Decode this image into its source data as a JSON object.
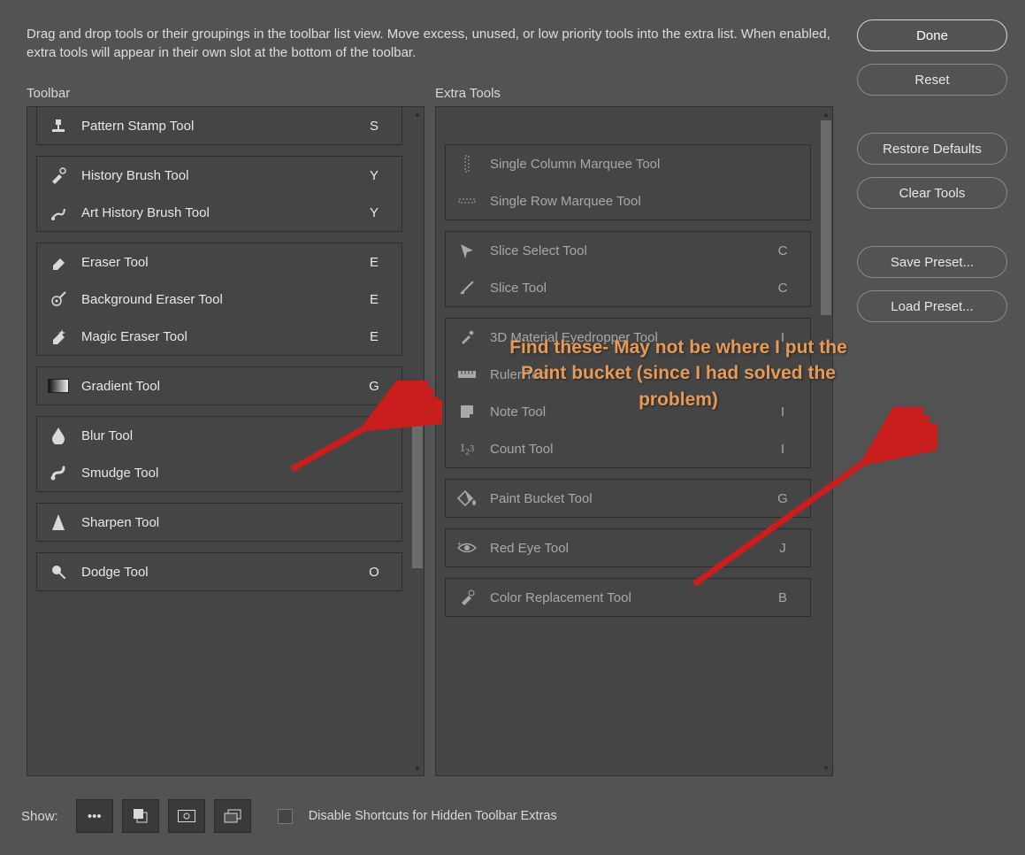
{
  "intro": "Drag and drop tools or their groupings in the toolbar list view. Move excess, unused, or low priority tools into the extra list. When enabled, extra tools will appear in their own slot at the bottom of the toolbar.",
  "section_labels": {
    "toolbar": "Toolbar",
    "extra": "Extra Tools"
  },
  "buttons": {
    "done": "Done",
    "reset": "Reset",
    "restore_defaults": "Restore Defaults",
    "clear_tools": "Clear Tools",
    "save_preset": "Save Preset...",
    "load_preset": "Load Preset..."
  },
  "bottom": {
    "show_label": "Show:",
    "disable_shortcuts_label": "Disable Shortcuts for Hidden Toolbar Extras"
  },
  "annotation": "Find these- May not be where I put the\nPaint bucket (since I had solved the\nproblem)",
  "toolbar_groups": [
    {
      "cut_top": true,
      "tools": [
        {
          "icon": "pattern-stamp-icon",
          "label": "Pattern Stamp Tool",
          "shortcut": "S"
        }
      ]
    },
    {
      "tools": [
        {
          "icon": "history-brush-icon",
          "label": "History Brush Tool",
          "shortcut": "Y"
        },
        {
          "icon": "art-history-brush-icon",
          "label": "Art History Brush Tool",
          "shortcut": "Y"
        }
      ]
    },
    {
      "tools": [
        {
          "icon": "eraser-icon",
          "label": "Eraser Tool",
          "shortcut": "E"
        },
        {
          "icon": "background-eraser-icon",
          "label": "Background Eraser Tool",
          "shortcut": "E"
        },
        {
          "icon": "magic-eraser-icon",
          "label": "Magic Eraser Tool",
          "shortcut": "E"
        }
      ]
    },
    {
      "tools": [
        {
          "icon": "gradient-icon",
          "label": "Gradient Tool",
          "shortcut": "G"
        }
      ]
    },
    {
      "tools": [
        {
          "icon": "blur-icon",
          "label": "Blur Tool",
          "shortcut": ""
        },
        {
          "icon": "smudge-icon",
          "label": "Smudge Tool",
          "shortcut": ""
        }
      ]
    },
    {
      "tools": [
        {
          "icon": "sharpen-icon",
          "label": "Sharpen Tool",
          "shortcut": ""
        }
      ]
    },
    {
      "tools": [
        {
          "icon": "dodge-icon",
          "label": "Dodge Tool",
          "shortcut": "O"
        }
      ]
    }
  ],
  "extra_groups": [
    {
      "tools": [
        {
          "icon": "single-col-marquee-icon",
          "label": "Single Column Marquee Tool",
          "shortcut": ""
        },
        {
          "icon": "single-row-marquee-icon",
          "label": "Single Row Marquee Tool",
          "shortcut": ""
        }
      ]
    },
    {
      "tools": [
        {
          "icon": "slice-select-icon",
          "label": "Slice Select Tool",
          "shortcut": "C"
        },
        {
          "icon": "slice-icon",
          "label": "Slice Tool",
          "shortcut": "C"
        }
      ]
    },
    {
      "tools": [
        {
          "icon": "material-eyedropper-icon",
          "label": "3D Material Eyedropper Tool",
          "shortcut": "I"
        },
        {
          "icon": "ruler-icon",
          "label": "Ruler Tool",
          "shortcut": "I"
        },
        {
          "icon": "note-icon",
          "label": "Note Tool",
          "shortcut": "I"
        },
        {
          "icon": "count-icon",
          "label": "Count Tool",
          "shortcut": "I"
        }
      ]
    },
    {
      "tools": [
        {
          "icon": "paint-bucket-icon",
          "label": "Paint Bucket Tool",
          "shortcut": "G"
        }
      ]
    },
    {
      "tools": [
        {
          "icon": "red-eye-icon",
          "label": "Red Eye Tool",
          "shortcut": "J"
        }
      ]
    },
    {
      "tools": [
        {
          "icon": "color-replacement-icon",
          "label": "Color Replacement Tool",
          "shortcut": "B"
        }
      ]
    }
  ]
}
